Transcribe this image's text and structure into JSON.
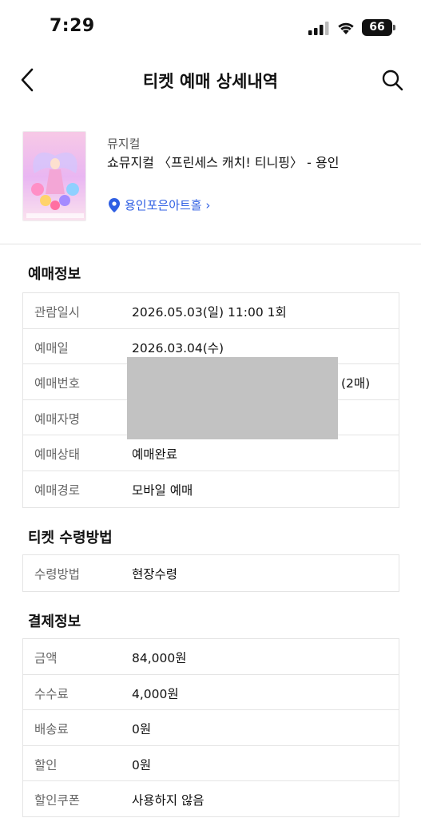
{
  "status_bar": {
    "time": "7:29",
    "battery": "66"
  },
  "nav": {
    "title": "티켓 예매 상세내역"
  },
  "show": {
    "genre": "뮤지컬",
    "title": "쇼뮤지컬 〈프린세스 캐치! 티니핑〉 - 용인",
    "venue": "용인포은아트홀 ›",
    "poster_caption": "프린세스 캐치! 티니핑"
  },
  "booking": {
    "section_title": "예매정보",
    "rows": [
      {
        "label": "관람일시",
        "value": "2026.05.03(일) 11:00 1회"
      },
      {
        "label": "예매일",
        "value": "2026.03.04(수)"
      },
      {
        "label": "예매번호",
        "value": ""
      },
      {
        "label": "예매자명",
        "value": ""
      },
      {
        "label": "예매상태",
        "value": "예매완료"
      },
      {
        "label": "예매경로",
        "value": "모바일 예매"
      }
    ],
    "quantity": "(2매)"
  },
  "pickup": {
    "section_title": "티켓 수령방법",
    "rows": [
      {
        "label": "수령방법",
        "value": "현장수령"
      }
    ]
  },
  "payment": {
    "section_title": "결제정보",
    "rows": [
      {
        "label": "금액",
        "value": "84,000원"
      },
      {
        "label": "수수료",
        "value": "4,000원"
      },
      {
        "label": "배송료",
        "value": "0원"
      },
      {
        "label": "할인",
        "value": "0원"
      },
      {
        "label": "할인쿠폰",
        "value": "사용하지 않음"
      }
    ]
  },
  "colors": {
    "link": "#2f5fe3",
    "border": "#e4e4e4",
    "redaction": "#c2c2c2"
  }
}
